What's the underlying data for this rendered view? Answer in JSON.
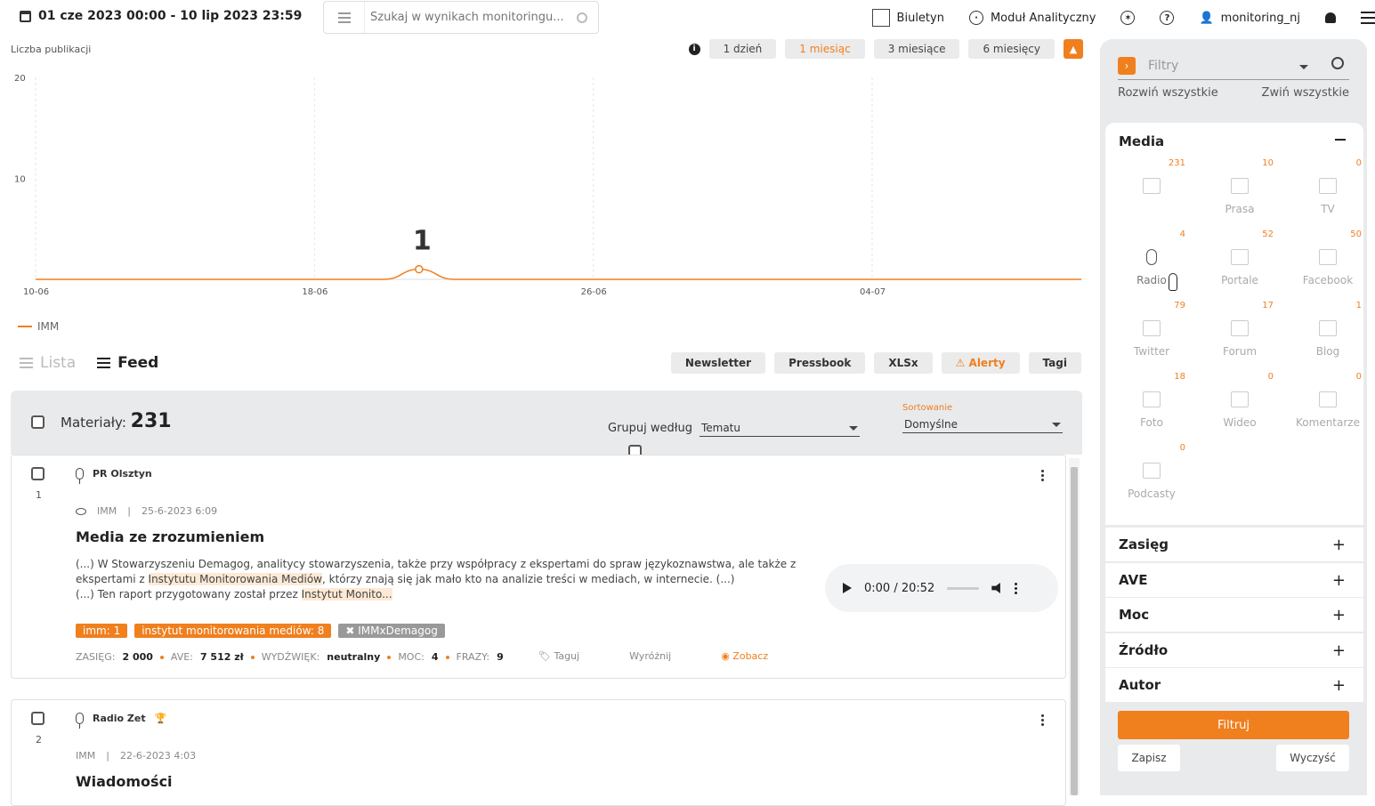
{
  "header": {
    "date_range": "01 cze 2023 00:00 - 10 lip 2023 23:59",
    "search_placeholder": "Szukaj w wynikach monitoringu...",
    "nav": [
      {
        "label": "Biuletyn",
        "icon": "bulletin-icon"
      },
      {
        "label": "Moduł Analityczny",
        "icon": "network-icon"
      }
    ],
    "user": "monitoring_nj"
  },
  "chart": {
    "ylabel": "Liczba publikacji",
    "ranges": [
      "1 dzień",
      "1 miesiąc",
      "3 miesiące",
      "6 miesięcy"
    ],
    "active_range": "1 miesiąc",
    "peak_label": "1"
  },
  "chart_data": {
    "type": "line",
    "x": [
      "10-06",
      "11-06",
      "12-06",
      "13-06",
      "14-06",
      "15-06",
      "16-06",
      "17-06",
      "18-06",
      "19-06",
      "20-06",
      "21-06",
      "22-06",
      "23-06",
      "24-06",
      "25-06",
      "26-06",
      "27-06",
      "28-06",
      "29-06",
      "30-06",
      "01-07",
      "02-07",
      "03-07",
      "04-07",
      "05-07",
      "06-07",
      "07-07",
      "08-07",
      "09-07",
      "10-07"
    ],
    "series": [
      {
        "name": "IMM",
        "values": [
          0,
          0,
          0,
          0,
          0,
          0,
          0,
          0,
          0,
          0,
          0,
          1,
          0,
          0,
          0,
          0,
          0,
          0,
          0,
          0,
          0,
          0,
          0,
          0,
          0,
          0,
          0,
          0,
          0,
          0,
          0
        ]
      }
    ],
    "xticks": [
      "10-06",
      "18-06",
      "26-06",
      "04-07"
    ],
    "yticks": [
      "10",
      "20"
    ],
    "ylabel": "Liczba publikacji",
    "ylim": [
      0,
      20
    ],
    "grid": true,
    "legend": "bottom-left",
    "color": "#f07f1e"
  },
  "feed": {
    "view_list": "Lista",
    "view_feed": "Feed",
    "exports": [
      "Newsletter",
      "Pressbook",
      "XLSx",
      "Alerty",
      "Tagi"
    ],
    "materials_label": "Materiały:",
    "materials_count": "231",
    "group_label": "Grupuj według",
    "group_value": "Tematu",
    "sort_label": "Sortowanie",
    "sort_value": "Domyślne"
  },
  "items": [
    {
      "num": "1",
      "source": "PR Olsztyn",
      "project": "IMM",
      "date": "25-6-2023 6:09",
      "title": "Media ze zrozumieniem",
      "excerpt_1": "(...) W Stowarzyszeniu Demagog, analitycy stowarzyszenia, także przy współpracy z ekspertami do spraw językoznawstwa, ale także z ekspertami z ",
      "excerpt_hl1": "Instytutu Monitorowania Mediów",
      "excerpt_2": ", którzy znają się jak mało kto na analizie treści w mediach, w internecie. (...)",
      "excerpt_3": "(...) Ten raport przygotowany został przez ",
      "excerpt_hl2": "Instytut Monito...",
      "audio_time": "0:00 / 20:52",
      "tags": [
        "imm: 1",
        "instytut monitorowania mediów: 8"
      ],
      "tag_grey": "IMMxDemagog",
      "zasieg": "2 000",
      "ave": "7 512 zł",
      "wydzwiek": "neutralny",
      "moc": "4",
      "frazy": "9",
      "actions": [
        "Taguj",
        "Wyróżnij",
        "Zobacz"
      ]
    },
    {
      "num": "2",
      "source": "Radio Zet",
      "project": "IMM",
      "date": "22-6-2023 4:03",
      "title": "Wiadomości"
    }
  ],
  "stat_labels": {
    "zasieg": "ZASIĘG:",
    "ave": "AVE:",
    "wydzwiek": "WYDŹWIĘK:",
    "moc": "MOC:",
    "frazy": "FRAZY:"
  },
  "sidebar": {
    "filters_placeholder": "Filtry",
    "expand_all": "Rozwiń wszystkie",
    "collapse_all": "Zwiń wszystkie",
    "media_title": "Media",
    "media": [
      {
        "label": "",
        "count": "231"
      },
      {
        "label": "Prasa",
        "count": "10"
      },
      {
        "label": "TV",
        "count": "0"
      },
      {
        "label": "Radio",
        "count": "4"
      },
      {
        "label": "Portale",
        "count": "52"
      },
      {
        "label": "Facebook",
        "count": "50"
      },
      {
        "label": "Twitter",
        "count": "79"
      },
      {
        "label": "Forum",
        "count": "17"
      },
      {
        "label": "Blog",
        "count": "1"
      },
      {
        "label": "Foto",
        "count": "18"
      },
      {
        "label": "Wideo",
        "count": "0"
      },
      {
        "label": "Komentarze",
        "count": "0"
      },
      {
        "label": "Podcasty",
        "count": "0"
      }
    ],
    "sections": [
      "Zasięg",
      "AVE",
      "Moc",
      "Źródło",
      "Autor"
    ],
    "filter_button": "Filtruj",
    "save_button": "Zapisz",
    "clear_button": "Wyczyść"
  }
}
